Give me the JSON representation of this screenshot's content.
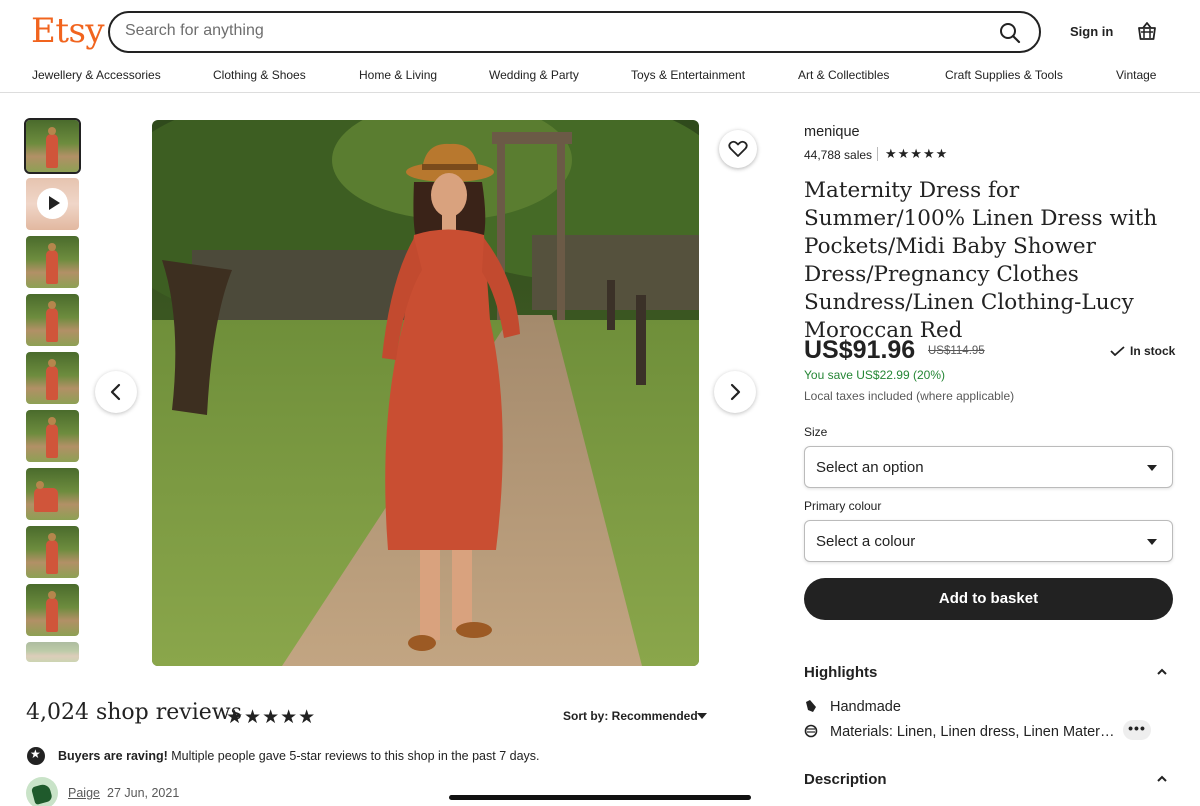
{
  "header": {
    "logo": "Etsy",
    "search_placeholder": "Search for anything",
    "sign_in": "Sign in"
  },
  "categories": [
    "Jewellery & Accessories",
    "Clothing & Shoes",
    "Home & Living",
    "Wedding & Party",
    "Toys & Entertainment",
    "Art & Collectibles",
    "Craft Supplies & Tools",
    "Vintage"
  ],
  "listing": {
    "shop_name": "menique",
    "sales": "44,788 sales",
    "shop_rating_stars": "★★★★★",
    "title": "Maternity Dress for Summer/100% Linen Dress with Pockets/Midi Baby Shower Dress/Pregnancy Clothes Sundress/Linen Clothing-Lucy Moroccan Red",
    "price": "US$91.96",
    "original_price": "US$114.95",
    "stock": "In stock",
    "saving": "You save US$22.99 (20%)",
    "tax_note": "Local taxes included (where applicable)",
    "size_label": "Size",
    "size_value": "Select an option",
    "colour_label": "Primary colour",
    "colour_value": "Select a colour",
    "add_button": "Add to basket",
    "highlights_title": "Highlights",
    "highlight_handmade": "Handmade",
    "highlight_materials": "Materials: Linen, Linen dress, Linen Mater…",
    "more": "•••",
    "description_title": "Description"
  },
  "reviews": {
    "count_text": "4,024 shop reviews",
    "stars": "★★★★★",
    "sort_label": "Sort by: Recommended",
    "raving_bold": "Buyers are raving!",
    "raving_text": " Multiple people gave 5-star reviews to this shop in the past 7 days.",
    "first_reviewer": "Paige",
    "first_date": "27 Jun, 2021"
  },
  "colors": {
    "brand": "#f1641e",
    "saving_green": "#258635",
    "button_dark": "#222222"
  }
}
